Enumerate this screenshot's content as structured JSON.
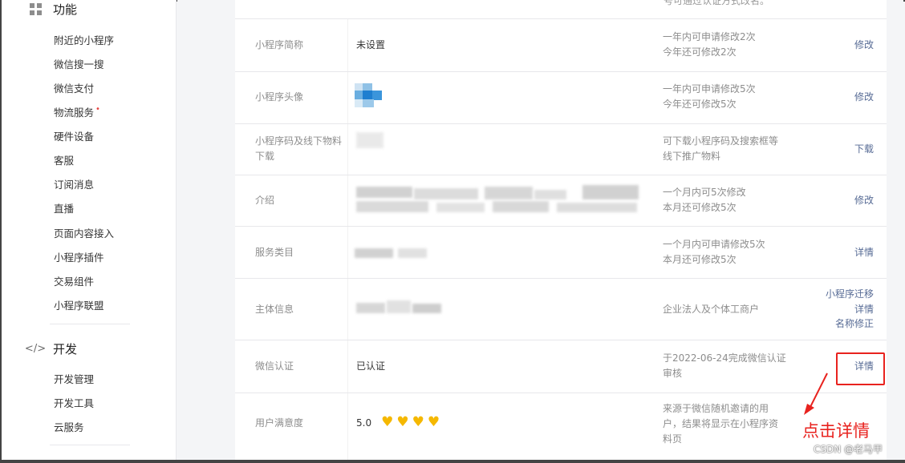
{
  "sidebar": {
    "section_features": {
      "title": "功能",
      "icon": "grid-icon"
    },
    "features_items": [
      {
        "label": "附近的小程序"
      },
      {
        "label": "微信搜一搜"
      },
      {
        "label": "微信支付"
      },
      {
        "label": "物流服务",
        "badge": "•"
      },
      {
        "label": "硬件设备"
      },
      {
        "label": "客服"
      },
      {
        "label": "订阅消息"
      },
      {
        "label": "直播"
      },
      {
        "label": "页面内容接入"
      },
      {
        "label": "小程序插件"
      },
      {
        "label": "交易组件"
      },
      {
        "label": "小程序联盟"
      }
    ],
    "section_dev": {
      "title": "开发",
      "icon": "code-icon",
      "icon_glyph": "</>"
    },
    "dev_items": [
      {
        "label": "开发管理"
      },
      {
        "label": "开发工具"
      },
      {
        "label": "云服务"
      }
    ]
  },
  "main": {
    "top_fragment": "号可通过认证方式改名。",
    "rows": [
      {
        "label": "小程序简称",
        "value": "未设置",
        "tip": "一年内可申请修改2次\n今年还可修改2次",
        "action": "修改"
      },
      {
        "label": "小程序头像",
        "value": "",
        "tip": "一年内可申请修改5次\n今年还可修改5次",
        "action": "修改"
      },
      {
        "label": "小程序码及线下物料\n下载",
        "value": "",
        "tip": "可下载小程序码及搜索框等\n线下推广物料",
        "action": "下载"
      },
      {
        "label": "介绍",
        "value": "",
        "tip": "一个月内可5次修改\n本月还可修改5次",
        "action": "修改"
      },
      {
        "label": "服务类目",
        "value": "",
        "tip": "一个月内可申请修改5次\n本月还可修改5次",
        "action": "详情"
      },
      {
        "label": "主体信息",
        "value": "",
        "tip": "企业法人及个体工商户",
        "actions": [
          "小程序迁移",
          "详情",
          "名称修正"
        ]
      },
      {
        "label": "微信认证",
        "value": "已认证",
        "tip": "于2022-06-24完成微信认证\n审核",
        "action": "详情"
      },
      {
        "label": "用户满意度",
        "score": "5.0",
        "hearts": 4,
        "tip": "来源于微信随机邀请的用\n户，结果将显示在小程序资\n料页",
        "action": ""
      }
    ]
  },
  "annotation": {
    "text": "点击详情",
    "color": "#e8221e"
  },
  "watermark": "CSDN @老马甲",
  "colors": {
    "link": "#576b95",
    "heart": "#f5b800",
    "annotation": "#e8221e"
  }
}
